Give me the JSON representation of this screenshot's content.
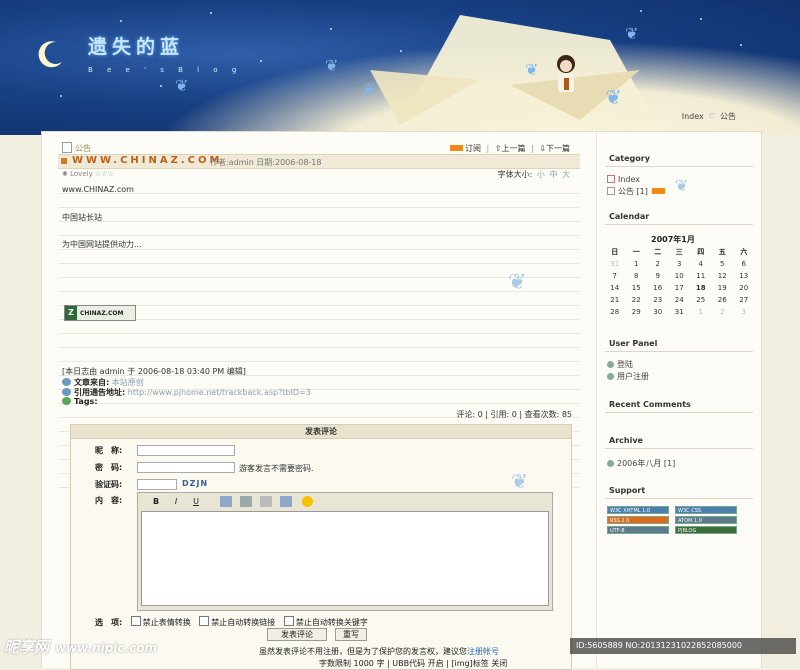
{
  "header": {
    "title": "遗失的蓝",
    "subtitle": "B e e ' s   B l o g"
  },
  "topnav": {
    "index": "Index",
    "notice": "公告"
  },
  "article": {
    "breadcrumb": "公告",
    "title": "WWW.CHINAZ.COM",
    "meta": "作者:admin 日期:2006-08-18",
    "nav": {
      "subscribe": "订阅",
      "prev": "上一篇",
      "next": "下一篇"
    },
    "rating_label": "Lovely",
    "font_size": {
      "label": "字体大小:",
      "small": "小",
      "medium": "中",
      "large": "大"
    },
    "paragraphs": [
      "www.CHINAZ.com",
      "中国站长站",
      "为中国网站提供动力..."
    ],
    "badge_text": "CHINAZ.COM",
    "edit_note": "[本日志由 admin 于 2006-08-18 03:40 PM 编辑]",
    "source_label": "文章来自:",
    "source_value": "本站原创",
    "trackback_label": "引用通告地址:",
    "trackback_value": "http://www.pjhome.net/trackback.asp?tbID=3",
    "tags_label": "Tags:",
    "stats": "评论: 0 | 引用: 0 | 查看次数: 85"
  },
  "comment_form": {
    "title": "发表评论",
    "nickname_label": "昵　称:",
    "password_label": "密　码:",
    "password_hint": "游客发言不需要密码.",
    "captcha_label": "验证码:",
    "captcha_value": "DZJN",
    "content_label": "内　容:",
    "toolbar": {
      "bold": "B",
      "italic": "I",
      "underline": "U"
    },
    "options_label": "选　项:",
    "options": [
      "禁止表情转换",
      "禁止自动转换链接",
      "禁止自动转换关键字"
    ],
    "submit_label": "发表评论",
    "reset_label": "重写",
    "note_prefix": "虽然发表评论不用注册，但是为了保护您的发言权，建议您",
    "note_link": "注册帐号",
    "note2": "字数限制 1000 字 | UBB代码 开启 | [img]标签 关闭"
  },
  "sidebar": {
    "category_title": "Category",
    "category_items": [
      "Index",
      "公告 [1]"
    ],
    "calendar_title": "Calendar",
    "calendar_month": "2007年1月",
    "weekdays": [
      "日",
      "一",
      "二",
      "三",
      "四",
      "五",
      "六"
    ],
    "weeks": [
      [
        "31",
        "1",
        "2",
        "3",
        "4",
        "5",
        "6"
      ],
      [
        "7",
        "8",
        "9",
        "10",
        "11",
        "12",
        "13"
      ],
      [
        "14",
        "15",
        "16",
        "17",
        "18",
        "19",
        "20"
      ],
      [
        "21",
        "22",
        "23",
        "24",
        "25",
        "26",
        "27"
      ],
      [
        "28",
        "29",
        "30",
        "31",
        "1",
        "2",
        "3"
      ]
    ],
    "user_panel_title": "User Panel",
    "user_panel_items": [
      "登陆",
      "用户注册"
    ],
    "recent_comments_title": "Recent Comments",
    "archive_title": "Archive",
    "archive_items": [
      "2006年八月 [1]"
    ],
    "support_title": "Support",
    "support_badges": [
      "W3C XHTML 1.0",
      "W3C CSS",
      "RSS 2.0",
      "ATOM 1.0",
      "UTF-8",
      "PJBLOG"
    ]
  },
  "watermark": {
    "brand": "昵享网",
    "url": "www.nipic.com",
    "id_text": "ID:5605889 NO:20131231022852085000"
  },
  "colors": {
    "sky": "#173f83",
    "title_text": "#c05f1a",
    "link": "#2b6fb3"
  }
}
